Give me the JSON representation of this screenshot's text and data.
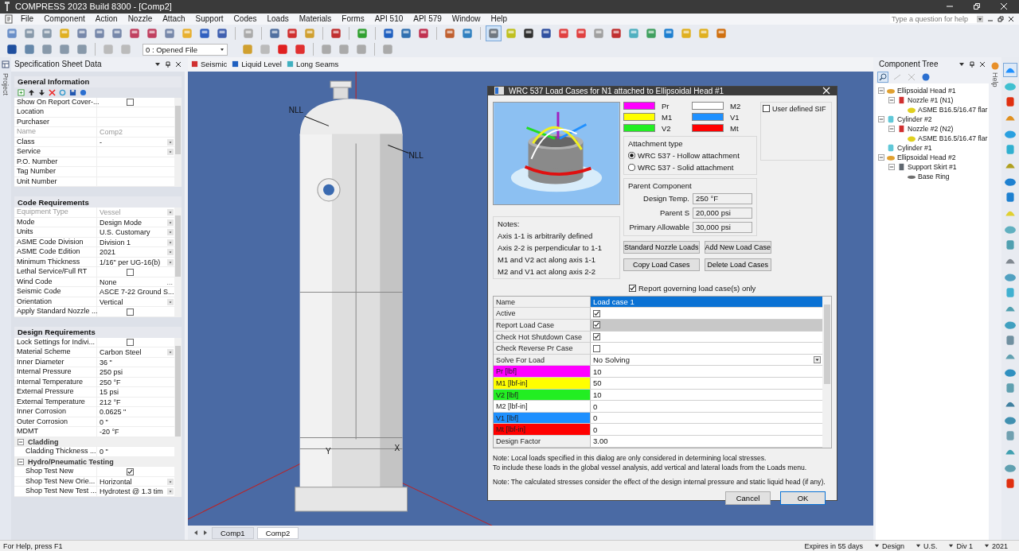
{
  "window": {
    "title": "COMPRESS 2023 Build 8300 - [Comp2]",
    "help_search": {
      "placeholder": "Type a question for help"
    }
  },
  "menu": [
    "File",
    "Component",
    "Action",
    "Nozzle",
    "Attach",
    "Support",
    "Codes",
    "Loads",
    "Materials",
    "Forms",
    "API 510",
    "API 579",
    "Window",
    "Help"
  ],
  "toolbar2": {
    "file_select": "0 : Opened File"
  },
  "project_tab": "Project",
  "spec_panel": {
    "title": "Specification Sheet Data",
    "sections": [
      {
        "title": "General Information",
        "toolbar": true,
        "rows": [
          {
            "label": "Show On Report Cover-...",
            "kind": "checkbox",
            "checked": false,
            "disabled": false
          },
          {
            "label": "Location",
            "kind": "text",
            "value": "",
            "disabled": false
          },
          {
            "label": "Purchaser",
            "kind": "text",
            "value": "",
            "disabled": false
          },
          {
            "label": "Name",
            "kind": "text",
            "value": "Comp2",
            "disabled": true
          },
          {
            "label": "Class",
            "kind": "dropdown",
            "value": "-",
            "disabled": false
          },
          {
            "label": "Service",
            "kind": "dropdown",
            "value": "",
            "disabled": false
          },
          {
            "label": "P.O. Number",
            "kind": "text",
            "value": "",
            "disabled": false
          },
          {
            "label": "Tag Number",
            "kind": "text",
            "value": "",
            "disabled": false
          },
          {
            "label": "Unit Number",
            "kind": "text",
            "value": "",
            "disabled": false
          }
        ]
      },
      {
        "title": "Code Requirements",
        "toolbar": false,
        "rows": [
          {
            "label": "Equipment Type",
            "kind": "dropdown",
            "value": "Vessel",
            "disabled": true
          },
          {
            "label": "Mode",
            "kind": "dropdown",
            "value": "Design Mode",
            "disabled": false
          },
          {
            "label": "Units",
            "kind": "dropdown",
            "value": "U.S. Customary",
            "disabled": false
          },
          {
            "label": "ASME Code Division",
            "kind": "dropdown",
            "value": "Division 1",
            "disabled": false
          },
          {
            "label": "ASME Code Edition",
            "kind": "dropdown",
            "value": "2021",
            "disabled": false
          },
          {
            "label": "Minimum Thickness",
            "kind": "dropdown",
            "value": "1/16\" per UG-16(b)",
            "disabled": false
          },
          {
            "label": "Lethal Service/Full RT",
            "kind": "checkbox",
            "checked": false,
            "disabled": false
          },
          {
            "label": "Wind Code",
            "kind": "ellipsis",
            "value": "None",
            "button": "...",
            "disabled": false
          },
          {
            "label": "Seismic Code",
            "kind": "text",
            "value": "ASCE 7-22 Ground S...",
            "disabled": false
          },
          {
            "label": "Orientation",
            "kind": "dropdown",
            "value": "Vertical",
            "disabled": false
          },
          {
            "label": "Apply Standard Nozzle ...",
            "kind": "checkbox",
            "checked": false,
            "disabled": false
          }
        ]
      },
      {
        "title": "Design Requirements",
        "toolbar": false,
        "rows": [
          {
            "label": "Lock Settings for Indivi...",
            "kind": "checkbox",
            "checked": false,
            "disabled": false
          },
          {
            "label": "Material Scheme",
            "kind": "dropdown",
            "value": "Carbon Steel",
            "disabled": false
          },
          {
            "label": "Inner Diameter",
            "kind": "text",
            "value": "36 \"",
            "disabled": false
          },
          {
            "label": "Internal Pressure",
            "kind": "text",
            "value": "250 psi",
            "disabled": false
          },
          {
            "label": "Internal Temperature",
            "kind": "text",
            "value": "250 °F",
            "disabled": false
          },
          {
            "label": "External Pressure",
            "kind": "text",
            "value": "15 psi",
            "disabled": false
          },
          {
            "label": "External Temperature",
            "kind": "text",
            "value": "212 °F",
            "disabled": false
          },
          {
            "label": "Inner Corrosion",
            "kind": "text",
            "value": "0.0625 \"",
            "disabled": false
          },
          {
            "label": "Outer Corrosion",
            "kind": "text",
            "value": "0 \"",
            "disabled": false
          },
          {
            "label": "MDMT",
            "kind": "text",
            "value": "-20 °F",
            "disabled": false
          },
          {
            "label": "Cladding",
            "kind": "group",
            "expanded": true,
            "children": [
              {
                "label": "Cladding Thickness ...",
                "kind": "text",
                "value": "0 \"",
                "disabled": false
              }
            ]
          },
          {
            "label": "Hydro/Pneumatic Testing",
            "kind": "group",
            "expanded": true,
            "children": [
              {
                "label": "Shop Test New",
                "kind": "checkbox",
                "checked": true,
                "disabled": false
              },
              {
                "label": "Shop Test New Orie...",
                "kind": "dropdown",
                "value": "Horizontal",
                "disabled": false
              },
              {
                "label": "Shop Test New Test ...",
                "kind": "dropdown",
                "value": "Hydrotest @ 1.3 tim",
                "disabled": false
              }
            ]
          }
        ]
      }
    ]
  },
  "view_tabs": [
    "Seismic",
    "Liquid Level",
    "Long Seams"
  ],
  "viewport": {
    "labels": [
      "NLL",
      "NLL"
    ],
    "axes": [
      "Y",
      "X"
    ]
  },
  "document_tabs": [
    {
      "label": "Comp1",
      "selected": false
    },
    {
      "label": "Comp2",
      "selected": true
    }
  ],
  "dialog": {
    "title": "WRC 537 Load Cases for N1 attached to Ellipsoidal Head #1",
    "legend": [
      {
        "label": "Pr",
        "color": "#ff00ff"
      },
      {
        "label": "M2",
        "color": "#ffffff"
      },
      {
        "label": "M1",
        "color": "#ffff00"
      },
      {
        "label": "V1",
        "color": "#1e90ff"
      },
      {
        "label": "V2",
        "color": "#22ee22"
      },
      {
        "label": "Mt",
        "color": "#ff0000"
      }
    ],
    "user_defined_sif": {
      "label": "User defined SIF",
      "checked": false
    },
    "attachment_type": {
      "title": "Attachment type",
      "options": [
        {
          "label": "WRC 537 - Hollow attachment",
          "selected": true
        },
        {
          "label": "WRC 537 - Solid attachment",
          "selected": false
        }
      ]
    },
    "parent_component": {
      "title": "Parent Component",
      "fields": [
        {
          "label": "Design Temp.",
          "value": "250 °F"
        },
        {
          "label": "Parent S",
          "value": "20,000 psi"
        },
        {
          "label": "Primary Allowable",
          "value": "30,000 psi"
        }
      ]
    },
    "notes": {
      "title": "Notes:",
      "lines": [
        "Axis 1-1 is arbitrarily defined",
        "Axis 2-2 is perpendicular to 1-1",
        "M1 and V2 act along axis 1-1",
        "M2 and V1 act along axis 2-2"
      ]
    },
    "buttons": [
      "Standard Nozzle Loads",
      "Add New Load Case",
      "Copy Load Cases",
      "Delete Load Cases"
    ],
    "report_governing": {
      "label": "Report governing load case(s) only",
      "checked": true
    },
    "grid": [
      {
        "label": "Name",
        "kind": "text",
        "value": "Load case 1",
        "selected": true,
        "shaded": false
      },
      {
        "label": "Active",
        "kind": "checkbox",
        "checked": true,
        "selected": false,
        "shaded": false
      },
      {
        "label": "Report Load Case",
        "kind": "checkbox",
        "checked": true,
        "selected": false,
        "shaded": true
      },
      {
        "label": "Check Hot Shutdown Case",
        "kind": "checkbox",
        "checked": true,
        "selected": false,
        "shaded": false
      },
      {
        "label": "Check Reverse Pr Case",
        "kind": "checkbox",
        "checked": false,
        "selected": false,
        "shaded": false
      },
      {
        "label": "Solve For Load",
        "kind": "dropdown",
        "value": "No Solving",
        "selected": false,
        "shaded": false
      },
      {
        "label": "Pr [lbf]",
        "kind": "text",
        "value": "10",
        "color": "#ff00ff",
        "selected": false,
        "shaded": false
      },
      {
        "label": "M1 [lbf-in]",
        "kind": "text",
        "value": "50",
        "color": "#ffff00",
        "selected": false,
        "shaded": false
      },
      {
        "label": "V2 [lbf]",
        "kind": "text",
        "value": "10",
        "color": "#22ee22",
        "selected": false,
        "shaded": false
      },
      {
        "label": "M2 [lbf-in]",
        "kind": "text",
        "value": "0",
        "color": "#ffffff",
        "selected": false,
        "shaded": false
      },
      {
        "label": "V1 [lbf]",
        "kind": "text",
        "value": "0",
        "color": "#1e90ff",
        "selected": false,
        "shaded": false
      },
      {
        "label": "Mt [lbf-in]",
        "kind": "text",
        "value": "0",
        "color": "#ff0000",
        "selected": false,
        "shaded": false
      },
      {
        "label": "Design Factor",
        "kind": "text",
        "value": "3.00",
        "selected": false,
        "shaded": false
      }
    ],
    "footnotes": [
      "Note:  Local loads specified in this dialog are only considered in determining local stresses.\nTo include these loads in the global vessel analysis, add vertical and lateral loads from the Loads menu.",
      "Note: The calculated stresses consider the effect of the design internal pressure and static liquid head (if any)."
    ],
    "actions": [
      "Cancel",
      "OK"
    ]
  },
  "component_tree": {
    "title": "Component Tree",
    "nodes": [
      {
        "label": "Ellipsoidal Head #1",
        "kind": "head",
        "expanded": true,
        "children": [
          {
            "label": "Nozzle #1 (N1)",
            "kind": "nozzle",
            "expanded": true,
            "children": [
              {
                "label": "ASME B16.5/16.47 flar",
                "kind": "flange"
              }
            ]
          }
        ]
      },
      {
        "label": "Cylinder #2",
        "kind": "cylinder",
        "expanded": true,
        "children": [
          {
            "label": "Nozzle #2 (N2)",
            "kind": "nozzle",
            "expanded": true,
            "children": [
              {
                "label": "ASME B16.5/16.47 flar",
                "kind": "flange"
              }
            ]
          }
        ]
      },
      {
        "label": "Cylinder #1",
        "kind": "cylinder"
      },
      {
        "label": "Ellipsoidal Head #2",
        "kind": "head",
        "expanded": true,
        "children": [
          {
            "label": "Support Skirt #1",
            "kind": "skirt",
            "expanded": true,
            "children": [
              {
                "label": "Base Ring",
                "kind": "ring"
              }
            ]
          }
        ]
      }
    ]
  },
  "help_tab": "Help",
  "status_bar": [
    {
      "text": "For Help, press F1",
      "kind": "text"
    },
    {
      "text": "Expires in 55 days",
      "kind": "text"
    },
    {
      "text": "Design",
      "kind": "dropdown"
    },
    {
      "text": "U.S.",
      "kind": "dropdown"
    },
    {
      "text": "Div 1",
      "kind": "dropdown"
    },
    {
      "text": "2021",
      "kind": "dropdown"
    }
  ]
}
